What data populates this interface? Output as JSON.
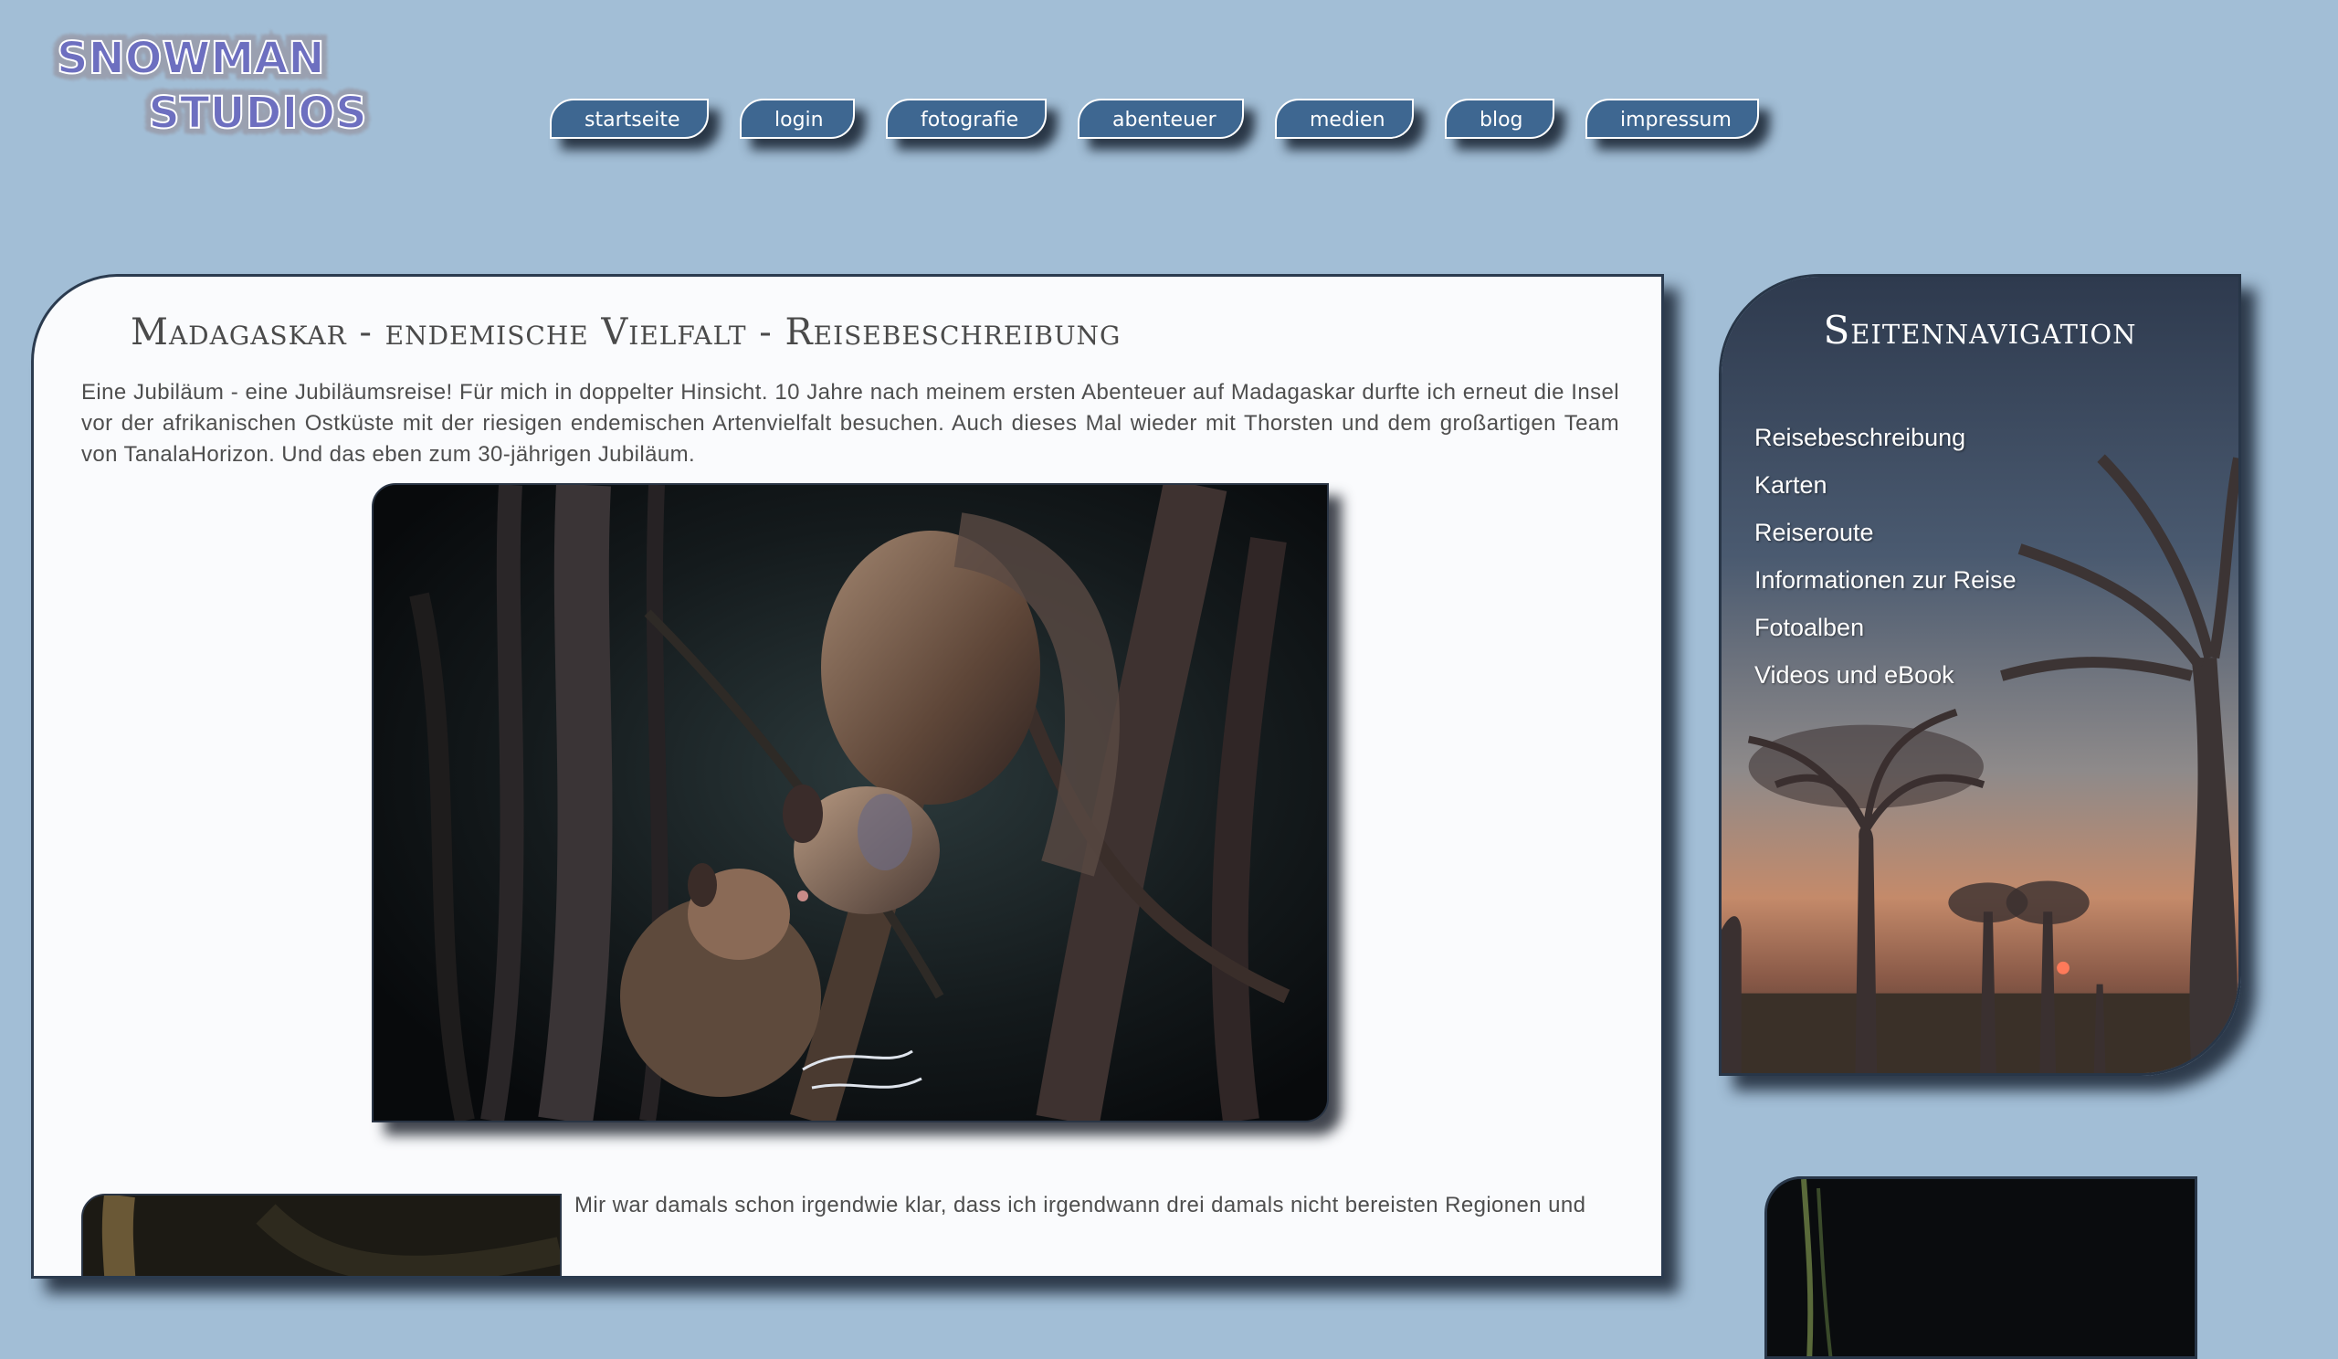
{
  "logo": {
    "line1": "SNOWMAN",
    "line2": "STUDIOS"
  },
  "nav": {
    "items": [
      {
        "label": "startseite"
      },
      {
        "label": "login"
      },
      {
        "label": "fotografie"
      },
      {
        "label": "abenteuer"
      },
      {
        "label": "medien"
      },
      {
        "label": "blog"
      },
      {
        "label": "impressum"
      }
    ]
  },
  "main": {
    "title": "Madagaskar - endemische Vielfalt - Reisebeschreibung",
    "intro": "Eine Jubiläum - eine Jubiläumsreise! Für mich in doppelter Hinsicht. 10 Jahre nach meinem ersten Abenteuer auf Madagaskar durfte ich erneut die Insel vor der afrikanischen Ostküste mit der riesigen endemischen Artenvielfalt besuchen. Auch dieses Mal wieder mit Thorsten und dem großartigen Team von TanalaHorizon. Und das eben zum 30-jährigen Jubiläum.",
    "second_text": "Mir war damals schon irgendwie klar, dass ich irgendwann drei damals nicht bereisten Regionen und"
  },
  "sidenav": {
    "title": "Seitennavigation",
    "items": [
      {
        "label": "Reisebeschreibung"
      },
      {
        "label": "Karten"
      },
      {
        "label": "Reiseroute"
      },
      {
        "label": "Informationen zur Reise"
      },
      {
        "label": "Fotoalben"
      },
      {
        "label": "Videos und eBook"
      }
    ]
  },
  "colors": {
    "background": "#a2bed6",
    "nav_button": "#3e6791",
    "panel": "#fafbfd",
    "border": "#2b3b4f"
  }
}
